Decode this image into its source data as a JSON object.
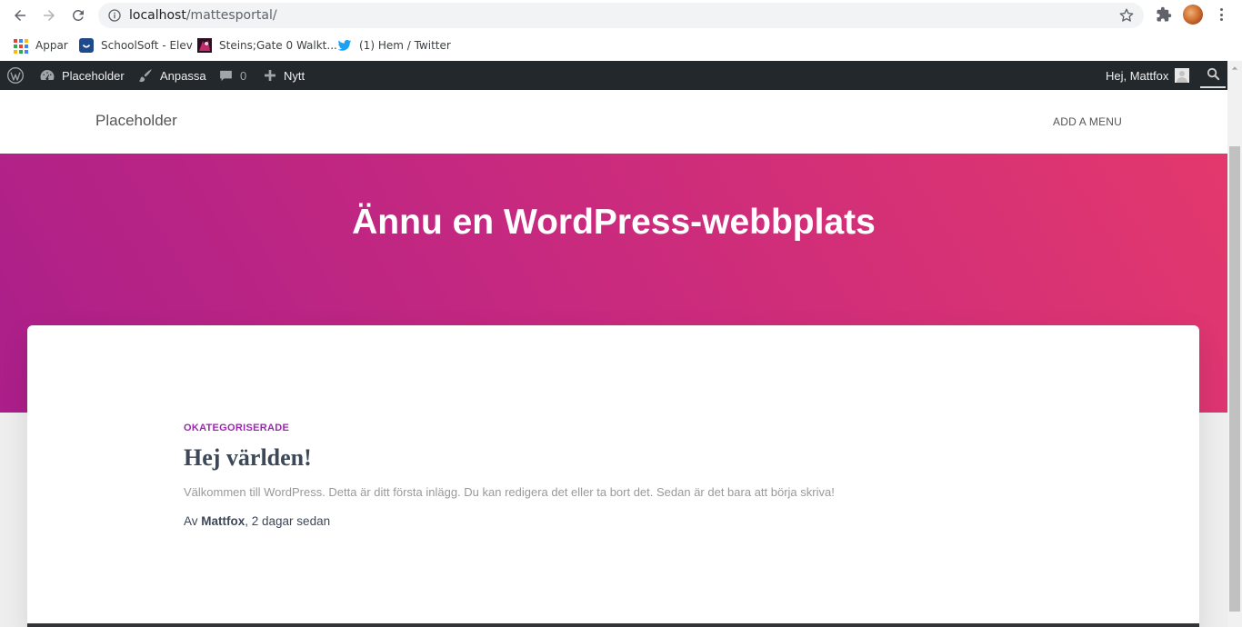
{
  "browser": {
    "url_host": "localhost",
    "url_path": "/mattesportal/",
    "bookmarks": [
      {
        "label": "Appar",
        "icon": "apps-grid-icon"
      },
      {
        "label": "SchoolSoft - Elev",
        "icon": "schoolsoft-icon"
      },
      {
        "label": "Steins;Gate 0 Walkt...",
        "icon": "steinsgate-icon"
      },
      {
        "label": "(1) Hem / Twitter",
        "icon": "twitter-icon"
      }
    ]
  },
  "adminbar": {
    "site_name": "Placeholder",
    "customize": "Anpassa",
    "comments_count": "0",
    "new_label": "Nytt",
    "greeting": "Hej, Mattfox"
  },
  "site": {
    "title": "Placeholder",
    "menu_label": "ADD A MENU",
    "hero_title": "Ännu en WordPress-webbplats"
  },
  "post": {
    "category": "OKATEGORISERADE",
    "title": "Hej världen!",
    "excerpt": "Välkommen till WordPress. Detta är ditt första inlägg. Du kan redigera det eller ta bort det. Sedan är det bara att börja skriva!",
    "meta_prefix": "Av ",
    "author": "Mattfox",
    "meta_suffix": ", 2 dagar sedan"
  },
  "colors": {
    "adminbar_bg": "#23282d",
    "hero_gradient_start": "#ab1f8a",
    "hero_gradient_end": "#e3386d",
    "category_color": "#9c27b0",
    "title_color": "#3c4858"
  }
}
